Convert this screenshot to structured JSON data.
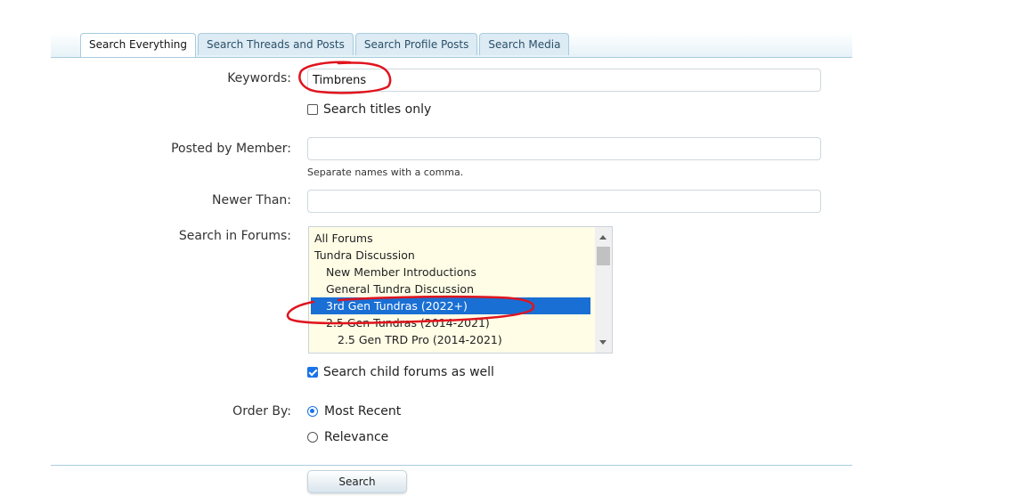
{
  "tabs": [
    {
      "label": "Search Everything",
      "active": true
    },
    {
      "label": "Search Threads and Posts",
      "active": false
    },
    {
      "label": "Search Profile Posts",
      "active": false
    },
    {
      "label": "Search Media",
      "active": false
    }
  ],
  "form": {
    "keywords": {
      "label": "Keywords:",
      "value": "Timbrens"
    },
    "titles_only": {
      "label": "Search titles only",
      "checked": false
    },
    "posted_by": {
      "label": "Posted by Member:",
      "value": "",
      "hint": "Separate names with a comma."
    },
    "newer_than": {
      "label": "Newer Than:",
      "value": ""
    },
    "forums": {
      "label": "Search in Forums:",
      "items": [
        {
          "label": "All Forums",
          "level": 0,
          "selected": false
        },
        {
          "label": "Tundra Discussion",
          "level": 0,
          "selected": false
        },
        {
          "label": "New Member Introductions",
          "level": 1,
          "selected": false
        },
        {
          "label": "General Tundra Discussion",
          "level": 1,
          "selected": false
        },
        {
          "label": "3rd Gen Tundras (2022+)",
          "level": 1,
          "selected": true
        },
        {
          "label": "2.5 Gen Tundras (2014-2021)",
          "level": 1,
          "selected": false
        },
        {
          "label": "2.5 Gen TRD Pro (2014-2021)",
          "level": 2,
          "selected": false
        }
      ]
    },
    "child_forums": {
      "label": "Search child forums as well",
      "checked": true
    },
    "order_by": {
      "label": "Order By:",
      "options": [
        {
          "label": "Most Recent",
          "checked": true
        },
        {
          "label": "Relevance",
          "checked": false
        }
      ]
    },
    "submit_label": "Search"
  },
  "colors": {
    "accent": "#1a73e8",
    "selected_row": "#1a6fd4",
    "list_background": "#fffde6",
    "annotation": "#e0141e"
  }
}
